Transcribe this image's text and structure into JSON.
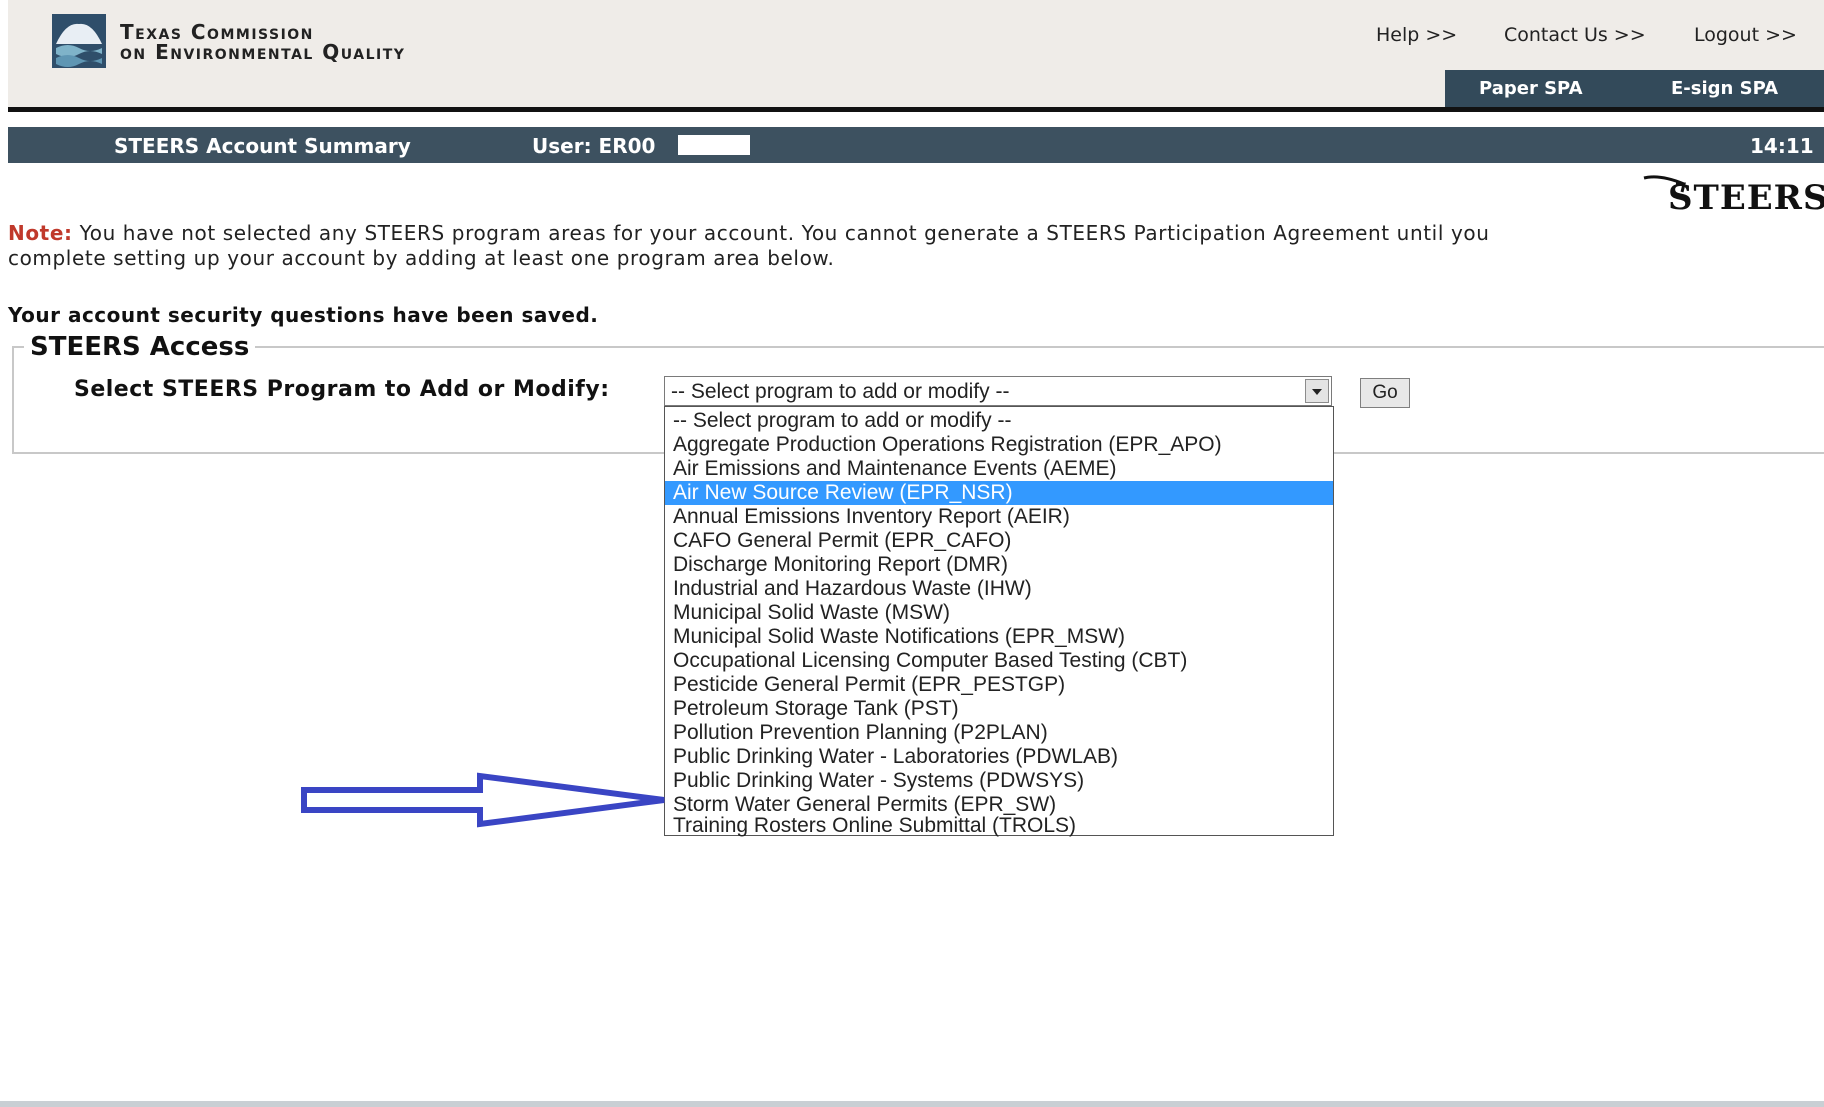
{
  "header": {
    "org_line1": "Texas Commission",
    "org_line2": "on Environmental Quality",
    "links": [
      "Help >>",
      "Contact Us >>",
      "Logout >>"
    ],
    "spa_links": [
      "Paper SPA",
      "E-sign SPA"
    ]
  },
  "title_bar": {
    "title": "STEERS Account Summary",
    "user": "User: ER00",
    "time": "14:11"
  },
  "brand": {
    "text": "STEERS",
    "color": "#111111"
  },
  "note": {
    "label": "Note:",
    "text": " You have not selected any STEERS program areas for your account. You cannot generate a STEERS Participation Agreement until you complete setting up your account by adding at least one program area below.",
    "label_color": "#c0392b"
  },
  "saved_message": "Your account security questions have been saved.",
  "access": {
    "legend": "STEERS Access",
    "select_label": "Select STEERS Program to Add or Modify:",
    "selected_value": "-- Select program to add or modify --",
    "go_label": "Go"
  },
  "dropdown": {
    "options": [
      "-- Select program to add or modify --",
      "Aggregate Production Operations Registration (EPR_APO)",
      "Air Emissions and Maintenance Events (AEME)",
      "Air New Source Review (EPR_NSR)",
      "Annual Emissions Inventory Report (AEIR)",
      "CAFO General Permit (EPR_CAFO)",
      "Discharge Monitoring Report (DMR)",
      "Industrial and Hazardous Waste (IHW)",
      "Municipal Solid Waste (MSW)",
      "Municipal Solid Waste Notifications (EPR_MSW)",
      "Occupational Licensing Computer Based Testing (CBT)",
      "Pesticide General Permit (EPR_PESTGP)",
      "Petroleum Storage Tank (PST)",
      "Pollution Prevention Planning (P2PLAN)",
      "Public Drinking Water - Laboratories (PDWLAB)",
      "Public Drinking Water - Systems (PDWSYS)",
      "Storm Water General Permits (EPR_SW)",
      "Training Rosters Online Submittal (TROLS)"
    ],
    "highlighted": "Air New Source Review (EPR_NSR)",
    "highlight_color": "#3399ff"
  },
  "annotation": {
    "arrow_color": "#3a45c4",
    "points_to": "Storm Water General Permits (EPR_SW)"
  }
}
